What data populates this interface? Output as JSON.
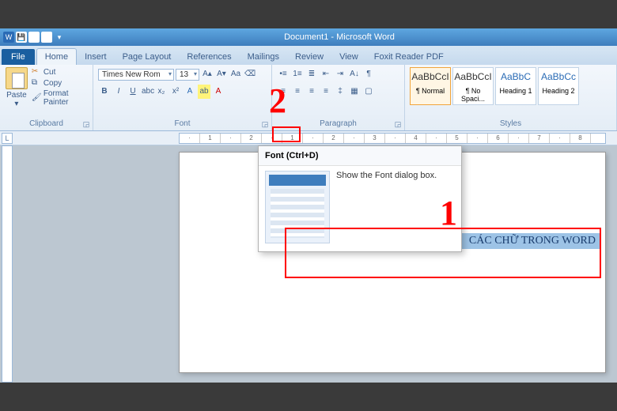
{
  "title": {
    "doc": "Document1",
    "app": "Microsoft Word"
  },
  "tabs": {
    "file": "File",
    "home": "Home",
    "insert": "Insert",
    "page_layout": "Page Layout",
    "references": "References",
    "mailings": "Mailings",
    "review": "Review",
    "view": "View",
    "foxit": "Foxit Reader PDF"
  },
  "clipboard": {
    "paste": "Paste",
    "cut": "Cut",
    "copy": "Copy",
    "format_painter": "Format Painter",
    "group": "Clipboard"
  },
  "font": {
    "name": "Times New Rom",
    "size": "13",
    "group": "Font"
  },
  "paragraph": {
    "group": "Paragraph"
  },
  "styles": {
    "group": "Styles",
    "items": [
      {
        "preview": "AaBbCcI",
        "name": "¶ Normal",
        "selected": true,
        "blue": false
      },
      {
        "preview": "AaBbCcI",
        "name": "¶ No Spaci...",
        "selected": false,
        "blue": false
      },
      {
        "preview": "AaBbC",
        "name": "Heading 1",
        "selected": false,
        "blue": true
      },
      {
        "preview": "AaBbCc",
        "name": "Heading 2",
        "selected": false,
        "blue": true
      }
    ]
  },
  "tooltip": {
    "title": "Font (Ctrl+D)",
    "body": "Show the Font dialog box."
  },
  "document": {
    "selected_text": "CÁC CHỮ TRONG WORD"
  },
  "annotations": {
    "one": "1",
    "two": "2"
  },
  "ruler_corner": "L"
}
